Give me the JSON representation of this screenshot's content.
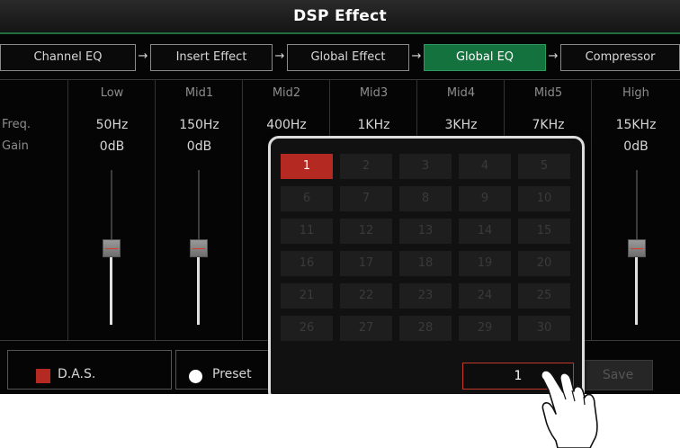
{
  "window": {
    "title": "DSP Effect"
  },
  "chain": {
    "tabs": [
      {
        "label": "Channel EQ",
        "active": false
      },
      {
        "label": "Insert Effect",
        "active": false
      },
      {
        "label": "Global Effect",
        "active": false
      },
      {
        "label": "Global EQ",
        "active": true
      },
      {
        "label": "Compressor",
        "active": false
      }
    ],
    "arrow_glyph": "→"
  },
  "eq": {
    "row_labels": {
      "freq": "Freq.",
      "gain": "Gain"
    },
    "bands": [
      {
        "name": "Low",
        "freq": "50Hz",
        "gain": "0dB"
      },
      {
        "name": "Mid1",
        "freq": "150Hz",
        "gain": "0dB"
      },
      {
        "name": "Mid2",
        "freq": "400Hz",
        "gain": ""
      },
      {
        "name": "Mid3",
        "freq": "1KHz",
        "gain": ""
      },
      {
        "name": "Mid4",
        "freq": "3KHz",
        "gain": ""
      },
      {
        "name": "Mid5",
        "freq": "7KHz",
        "gain": ""
      },
      {
        "name": "High",
        "freq": "15KHz",
        "gain": "0dB"
      }
    ]
  },
  "bottom": {
    "das_label": "D.A.S.",
    "preset_label": "Preset",
    "save_label": "Save"
  },
  "preset_popup": {
    "numbers": [
      "1",
      "2",
      "3",
      "4",
      "5",
      "6",
      "7",
      "8",
      "9",
      "10",
      "11",
      "12",
      "13",
      "14",
      "15",
      "16",
      "17",
      "18",
      "19",
      "20",
      "21",
      "22",
      "23",
      "24",
      "25",
      "26",
      "27",
      "28",
      "29",
      "30"
    ],
    "selected": "1",
    "input_value": "1"
  },
  "colors": {
    "accent_green": "#13723d",
    "accent_red": "#b42a22",
    "background": "#050505"
  },
  "icons": {
    "cursor": "pointing-hand-icon",
    "das_indicator": "red-square-icon",
    "preset_radio": "radio-dot-icon"
  }
}
